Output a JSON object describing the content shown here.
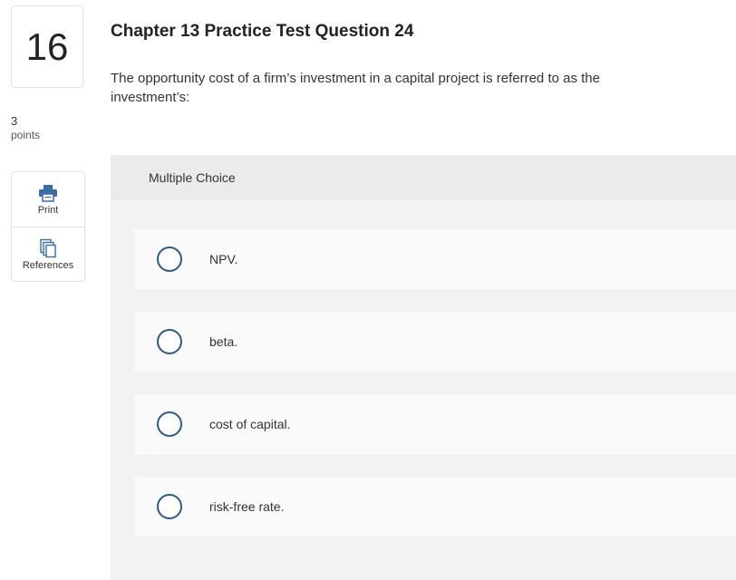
{
  "question": {
    "number": "16",
    "points_value": "3",
    "points_label": "points",
    "title": "Chapter 13 Practice Test Question 24",
    "text": "The opportunity cost of a firm’s investment in a capital project is referred to as the investment’s:"
  },
  "tools": {
    "print_label": "Print",
    "references_label": "References"
  },
  "answer_panel": {
    "type_label": "Multiple Choice",
    "options": [
      {
        "label": "NPV."
      },
      {
        "label": "beta."
      },
      {
        "label": "cost of capital."
      },
      {
        "label": "risk-free rate."
      }
    ]
  },
  "colors": {
    "accent": "#2c5a8a",
    "print_icon": "#3a6da6"
  },
  "icons": {
    "print": "printer-icon",
    "references": "references-icon"
  }
}
